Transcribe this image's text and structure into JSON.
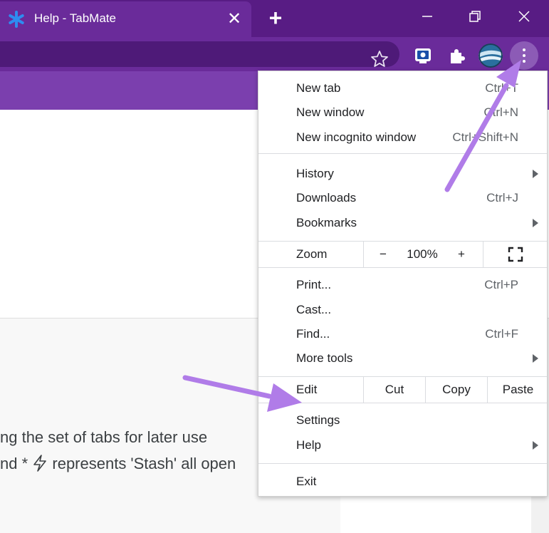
{
  "window": {
    "tab_title": "Help - TabMate",
    "tab_close": "✕",
    "new_tab": "+"
  },
  "colors": {
    "titlebar": "#581c84",
    "toolbar": "#6a2b9a",
    "page_header": "#7b3fae",
    "favicon": "#2e8cf0",
    "arrow": "#b07ce8"
  },
  "icons": [
    "asterisk-icon",
    "close-icon",
    "plus-icon",
    "minimize-icon",
    "restore-icon",
    "window-close-icon",
    "star-icon",
    "extension-icon",
    "puzzle-icon",
    "kebab-icon",
    "submenu-arrow-icon",
    "fullscreen-icon",
    "bolt-icon"
  ],
  "menu": {
    "new_tab": {
      "label": "New tab",
      "shortcut": "Ctrl+T"
    },
    "new_window": {
      "label": "New window",
      "shortcut": "Ctrl+N"
    },
    "new_incognito": {
      "label": "New incognito window",
      "shortcut": "Ctrl+Shift+N"
    },
    "history": {
      "label": "History"
    },
    "downloads": {
      "label": "Downloads",
      "shortcut": "Ctrl+J"
    },
    "bookmarks": {
      "label": "Bookmarks"
    },
    "zoom": {
      "label": "Zoom",
      "minus": "−",
      "value": "100%",
      "plus": "+"
    },
    "print": {
      "label": "Print...",
      "shortcut": "Ctrl+P"
    },
    "cast": {
      "label": "Cast..."
    },
    "find": {
      "label": "Find...",
      "shortcut": "Ctrl+F"
    },
    "more_tools": {
      "label": "More tools"
    },
    "edit": {
      "label": "Edit",
      "cut": "Cut",
      "copy": "Copy",
      "paste": "Paste"
    },
    "settings": {
      "label": "Settings"
    },
    "help": {
      "label": "Help"
    },
    "exit": {
      "label": "Exit"
    }
  },
  "page": {
    "line1": "ng the set of tabs for later use",
    "line2_pre": "nd * ",
    "line2_post": " represents 'Stash' all open"
  }
}
